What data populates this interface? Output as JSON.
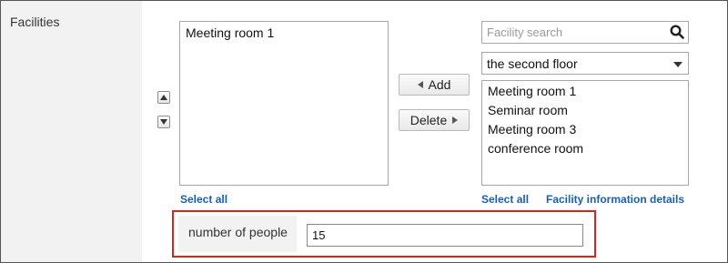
{
  "field": {
    "label": "Facilities"
  },
  "selected_list": {
    "items": [
      "Meeting room 1"
    ],
    "select_all": "Select all"
  },
  "actions": {
    "add": "Add",
    "delete": "Delete"
  },
  "search": {
    "placeholder": "Facility search",
    "value": ""
  },
  "group_select": {
    "value": "the second floor"
  },
  "available_list": {
    "items": [
      "Meeting room 1",
      "Seminar room",
      "Meeting room 3",
      "conference room"
    ],
    "select_all": "Select all",
    "details_link": "Facility information details"
  },
  "people": {
    "label": "number of people",
    "value": "15"
  },
  "icons": {
    "search": "search-icon",
    "up": "arrow-up-icon",
    "down": "arrow-down-icon",
    "dropdown": "chevron-down-icon"
  },
  "colors": {
    "link": "#1a5fb4",
    "highlight_border": "#d9241c",
    "label_bg": "#f2f2f2"
  }
}
